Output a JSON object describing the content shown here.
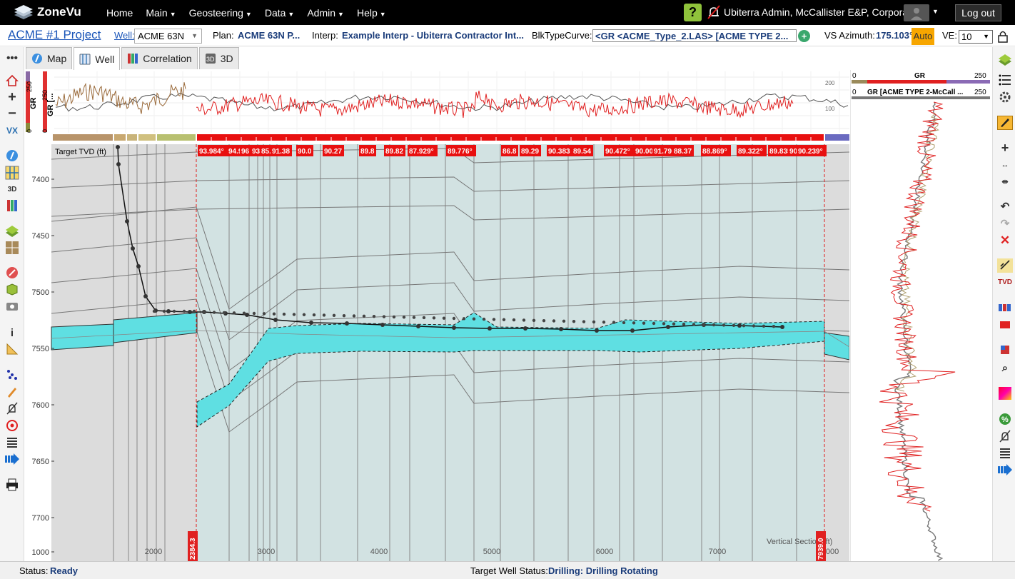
{
  "nav": {
    "logo": "ZoneVu",
    "items": [
      "Home",
      "Main",
      "Geosteering",
      "Data",
      "Admin",
      "Help"
    ],
    "user": "Ubiterra Admin, McCallister E&P, Corporate",
    "logout": "Log out",
    "help": "?"
  },
  "subbar": {
    "project": "ACME #1 Project",
    "well_label": "Well:",
    "well_value": "ACME 63N",
    "plan_label": "Plan:",
    "plan_value": "ACME 63N P...",
    "interp_label": "Interp:",
    "interp_value": "Example Interp - Ubiterra Contractor Int...",
    "blk_label": "BlkTypeCurve:",
    "blk_value": "<GR <ACME_Type_2.LAS> [ACME TYPE 2...",
    "vs_label": "VS Azimuth:",
    "vs_value": "175.103°",
    "auto": "Auto",
    "ve_label": "VE:",
    "ve_value": "10"
  },
  "tabs": [
    {
      "label": "Map",
      "icon": "compass-icon"
    },
    {
      "label": "Well",
      "icon": "well-icon"
    },
    {
      "label": "Correlation",
      "icon": "correlation-icon"
    },
    {
      "label": "3D",
      "icon": "cube-3d-icon"
    }
  ],
  "log_track": {
    "gr_label": "GR",
    "gr2_label": "GR [...",
    "scale_min": "0",
    "scale_max": "250",
    "right_ticks": [
      "200",
      "100"
    ]
  },
  "type_curve": {
    "gr_min": "0",
    "gr_label": "GR",
    "gr_max": "250",
    "tc_min": "0",
    "tc_label": "GR [ACME TYPE 2-McCall ...",
    "tc_max": "250"
  },
  "section": {
    "yaxis_title": "Target TVD (ft)",
    "xaxis_title": "Vertical Section (ft)",
    "y_ticks": [
      "7400",
      "7450",
      "7500",
      "7550",
      "7600",
      "7650",
      "7700",
      "1000"
    ],
    "x_ticks": [
      "2000",
      "3000",
      "4000",
      "5000",
      "6000",
      "7000",
      "8000"
    ],
    "left_marker": "2384.3",
    "right_marker": "7939.0",
    "dip_labels": [
      "93.984°",
      "94.9",
      "96",
      "93",
      "85.",
      "91.38",
      "90.0",
      "90.27",
      "89.8",
      "89.82",
      "87.929°",
      "89.776°",
      "86.8",
      "89.29",
      "90.383",
      "89.54",
      "90.472°",
      "90.002°",
      "91.79",
      "88.37",
      "88.869°",
      "89.322°",
      "89.835",
      "90.462°",
      "90.239°"
    ]
  },
  "status": {
    "label": "Status:",
    "value": "Ready",
    "target_label": "Target Well Status:",
    "target_value": "Drilling: Drilling Rotating"
  }
}
